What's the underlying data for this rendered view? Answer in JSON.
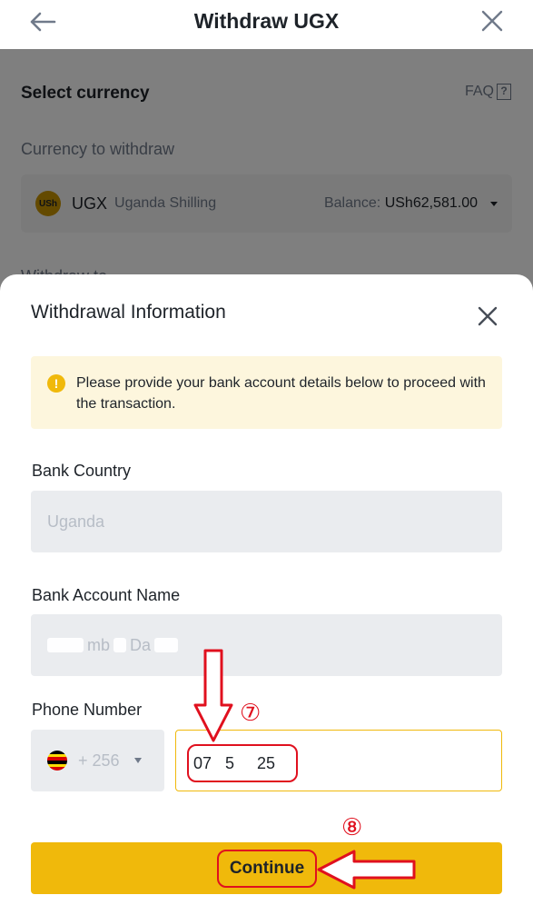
{
  "header": {
    "title": "Withdraw UGX"
  },
  "background_page": {
    "section_title": "Select currency",
    "faq_label": "FAQ",
    "faq_icon": "?",
    "currency_label": "Currency to withdraw",
    "coin_badge": "USh",
    "currency_code": "UGX",
    "currency_name": "Uganda Shilling",
    "balance_label": "Balance:",
    "balance_value": "USh62,581.00",
    "peek_label": "Withdraw to"
  },
  "sheet": {
    "title": "Withdrawal Information",
    "notice": "Please provide your bank account details below to proceed with the transaction.",
    "notice_icon": "!",
    "bank_country_label": "Bank Country",
    "bank_country_value": "Uganda",
    "bank_account_name_label": "Bank Account Name",
    "bank_account_name_value_part1": "mb",
    "bank_account_name_value_part2": "Da",
    "phone_label": "Phone Number",
    "phone_country_code": "+ 256",
    "phone_value": "07   5     25",
    "continue_label": "Continue"
  },
  "annotations": {
    "step7": "⑦",
    "step8": "⑧"
  },
  "colors": {
    "accent": "#f0b90b",
    "notice_bg": "#fdf6dd",
    "annotation": "#e0101e"
  },
  "icons": [
    "back-arrow-icon",
    "close-icon",
    "faq-question-icon",
    "currency-coin-icon",
    "dropdown-caret-icon",
    "info-warning-icon",
    "uganda-flag-icon",
    "down-arrow-annotation-icon",
    "left-arrow-annotation-icon"
  ]
}
